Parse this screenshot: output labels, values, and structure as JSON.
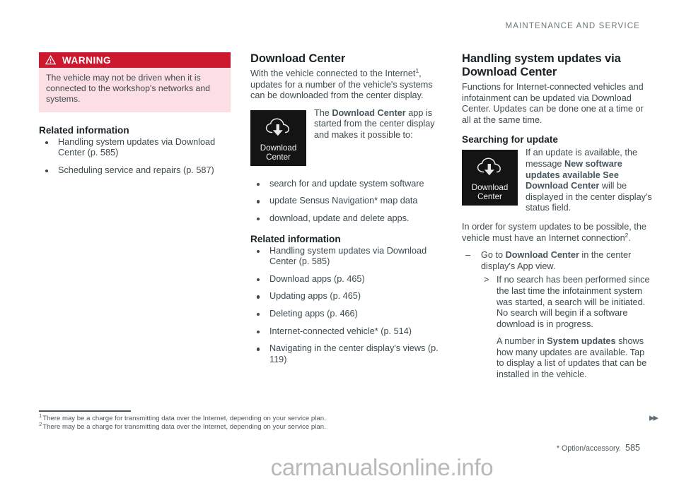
{
  "header": {
    "running_title": "MAINTENANCE AND SERVICE"
  },
  "colors": {
    "warning_red": "#cd1930",
    "warning_bg": "#fbdfe4",
    "body_text": "#3d4a4f",
    "heading_text": "#1b2226",
    "tile_bg": "#141414"
  },
  "column_left": {
    "warning": {
      "icon": "warning-triangle-icon",
      "title": "WARNING",
      "body": "The vehicle may not be driven when it is connected to the workshop's networks and systems."
    },
    "related_information": {
      "title": "Related information",
      "items": [
        "Handling system updates via Download Center (p. 585)",
        "Scheduling service and repairs (p. 587)"
      ]
    }
  },
  "column_middle": {
    "title": "Download Center",
    "intro_before": "With the vehicle connected to the Internet",
    "intro_footnote": "1",
    "intro_after": ", updates for a number of the vehicle's systems can be downloaded from the center display.",
    "app_tile": {
      "icon": "cloud-download-icon",
      "label_line1": "Download",
      "label_line2": "Center"
    },
    "figure_text_before": "The ",
    "figure_text_emph": "Download Center",
    "figure_text_after": " app is started from the center display and makes it possible to:",
    "capabilities": [
      "search for and update system software",
      "update Sensus Navigation* map data",
      "download, update and delete apps."
    ],
    "related_information": {
      "title": "Related information",
      "items": [
        "Handling system updates via Download Center (p. 585)",
        "Download apps (p. 465)",
        "Updating apps (p. 465)",
        "Deleting apps (p. 466)",
        "Internet-connected vehicle* (p. 514)",
        "Navigating in the center display's views (p. 119)"
      ]
    }
  },
  "column_right": {
    "title": "Handling system updates via Download Center",
    "intro": "Functions for Internet-connected vehicles and infotainment can be updated via Download Center. Updates can be done one at a time or all at the same time.",
    "search_heading": "Searching for update",
    "app_tile": {
      "icon": "cloud-download-icon",
      "label_line1": "Download",
      "label_line2": "Center"
    },
    "search_text_p1": "If an update is available, the message ",
    "search_text_emph1": "New software updates available See Download Center",
    "search_text_p2": " will be displayed in the center display's status field.",
    "requirement_before": "In order for system updates to be possible, the vehicle must have an Internet connection",
    "requirement_footnote": "2",
    "requirement_after": ".",
    "steps": {
      "dash_before": "Go to ",
      "dash_emph": "Download Center",
      "dash_after": " in the center display's App view.",
      "sub_items": [
        "If no search has been performed since the last time the infotainment system was started, a search will be initiated. No search will begin if a software download is in progress."
      ],
      "note_before": "A number in ",
      "note_emph": "System updates",
      "note_after": " shows how many updates are available. Tap to display a list of updates that can be installed in the vehicle."
    }
  },
  "footnotes": [
    {
      "marker": "1",
      "text": "There may be a charge for transmitting data over the Internet, depending on your service plan."
    },
    {
      "marker": "2",
      "text": "There may be a charge for transmitting data over the Internet, depending on your service plan."
    }
  ],
  "footer": {
    "option_note": "* Option/accessory.",
    "page_number": "585",
    "page_turn_icon": "double-chevron-right-icon",
    "watermark": "carmanualsonline.info"
  }
}
